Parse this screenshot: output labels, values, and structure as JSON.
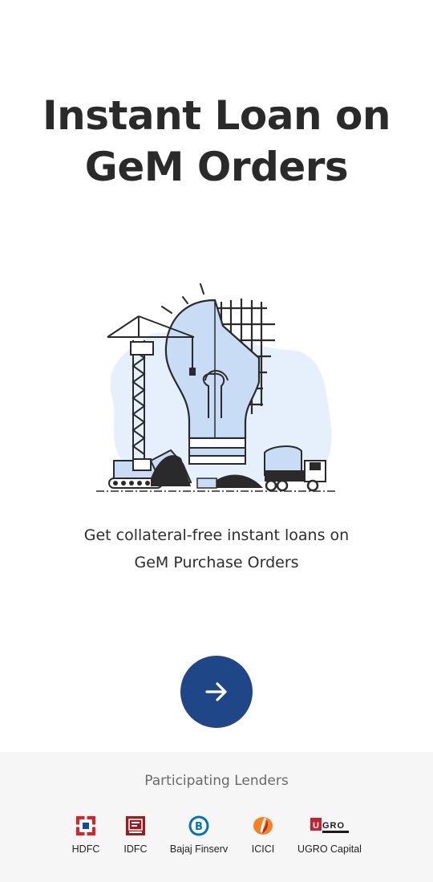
{
  "hero": {
    "title_line1": "Instant Loan on",
    "title_line2": "GeM Orders"
  },
  "description": {
    "line1": "Get collateral-free instant loans on",
    "line2": "GeM Purchase Orders"
  },
  "next_button": {
    "icon": "arrow-right-icon",
    "color": "#1f4687"
  },
  "lenders": {
    "title": "Participating Lenders",
    "items": [
      {
        "name": "HDFC",
        "icon": "hdfc-logo"
      },
      {
        "name": "IDFC",
        "icon": "idfc-logo"
      },
      {
        "name": "Bajaj Finserv",
        "icon": "bajaj-finserv-logo"
      },
      {
        "name": "ICICI",
        "icon": "icici-logo"
      },
      {
        "name": "UGRO Capital",
        "icon": "ugro-capital-logo",
        "logo_text_u": "U",
        "logo_text_gro": "GRO"
      }
    ]
  },
  "colors": {
    "title": "#2a2a2a",
    "accent": "#1f4687",
    "illustration_fill": "#c8dcf6",
    "footer_bg": "#f6f6f6"
  }
}
